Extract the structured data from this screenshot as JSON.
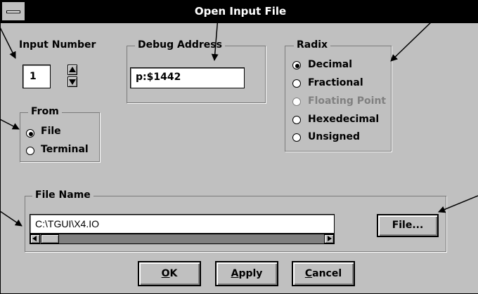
{
  "window": {
    "title": "Open Input File"
  },
  "input_number": {
    "label": "Input Number",
    "value": "1"
  },
  "debug_address": {
    "label": "Debug Address",
    "value": "p:$1442"
  },
  "radix": {
    "label": "Radix",
    "options": [
      {
        "label": "Decimal",
        "selected": true,
        "enabled": true
      },
      {
        "label": "Fractional",
        "selected": false,
        "enabled": true
      },
      {
        "label": "Floating Point",
        "selected": false,
        "enabled": false
      },
      {
        "label": "Hexedecimal",
        "selected": false,
        "enabled": true
      },
      {
        "label": "Unsigned",
        "selected": false,
        "enabled": true
      }
    ]
  },
  "from": {
    "label": "From",
    "options": [
      {
        "label": "File",
        "selected": true
      },
      {
        "label": "Terminal",
        "selected": false
      }
    ]
  },
  "file_name": {
    "label": "File Name",
    "value": "C:\\TGUI\\X4.IO",
    "browse_label": "File..."
  },
  "buttons": {
    "ok_mnemonic": "O",
    "ok_rest": "K",
    "apply_mnemonic": "A",
    "apply_rest": "pply",
    "cancel_mnemonic": "C",
    "cancel_rest": "ancel"
  },
  "colors": {
    "face": "#c0c0c0",
    "titlebar": "#000000",
    "disabled_text": "#808080"
  }
}
